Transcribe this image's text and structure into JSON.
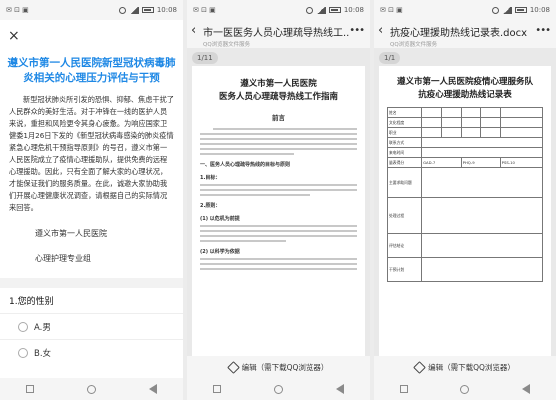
{
  "status": {
    "time": "10:08"
  },
  "panel1": {
    "back_glyph": "×",
    "title": "遵义市第一人民医院新型冠状病毒肺炎相关的心理压力评估与干预",
    "intro": "新型冠状肺炎所引发的恐惧、抑郁、焦虑干扰了人民群众的美好生活。对于冲锋在一线的医护人员来说，重担和风险更令其身心疲惫。为响应国家卫健委1月26日下发的《新型冠状病毒感染的肺炎疫情紧急心理危机干预指导原则》的号召，遵义市第一人民医院成立了疫情心理援助队，提供免费的远程心理援助。因此，只有全面了解大家的心理状况，才能保证我们的服务质量。在此，诚邀大家协助我们开展心理健康状况调查，请根据自己的实际情况来回答。",
    "sign_org": "遵义市第一人民医院",
    "sign_dept": "心理护理专业组",
    "question": "1.您的性别",
    "options": [
      "A.男",
      "B.女"
    ]
  },
  "panel2": {
    "title": "市一医医务人员心理疏导热线工...",
    "subtitle": "QQ浏览器文件服务",
    "page_badge": "1/11",
    "doc_title_1": "遵义市第一人民医院",
    "doc_title_2": "医务人员心理疏导热线工作指南",
    "preface": "前言",
    "sec1": "一、医务人员心理疏导热线的目标与原则",
    "sec1a": "1.目标：",
    "sec1b": "2.原则：",
    "sec1c": "(1) 以危机为前提",
    "sec1d": "(2) 以科学为依据",
    "edit_label": "编辑（需下载QQ浏览器）"
  },
  "panel3": {
    "title": "抗疫心理援助热线记录表.docx",
    "subtitle": "QQ浏览器文件服务",
    "page_badge": "1/1",
    "doc_title_1": "遵义市第一人民医院疫情心理服务队",
    "doc_title_2": "抗疫心理援助热线记录表",
    "table_labels": [
      "姓名",
      "文化程度",
      "职业",
      "联系方式",
      "来电时间",
      "量表得分",
      "主要求助问题",
      "处理过程",
      "评估结论",
      "干预计划"
    ],
    "scale_items": [
      "GAD-7",
      "PHQ-9",
      "PSS-10"
    ],
    "edit_label": "编辑（需下载QQ浏览器）"
  }
}
